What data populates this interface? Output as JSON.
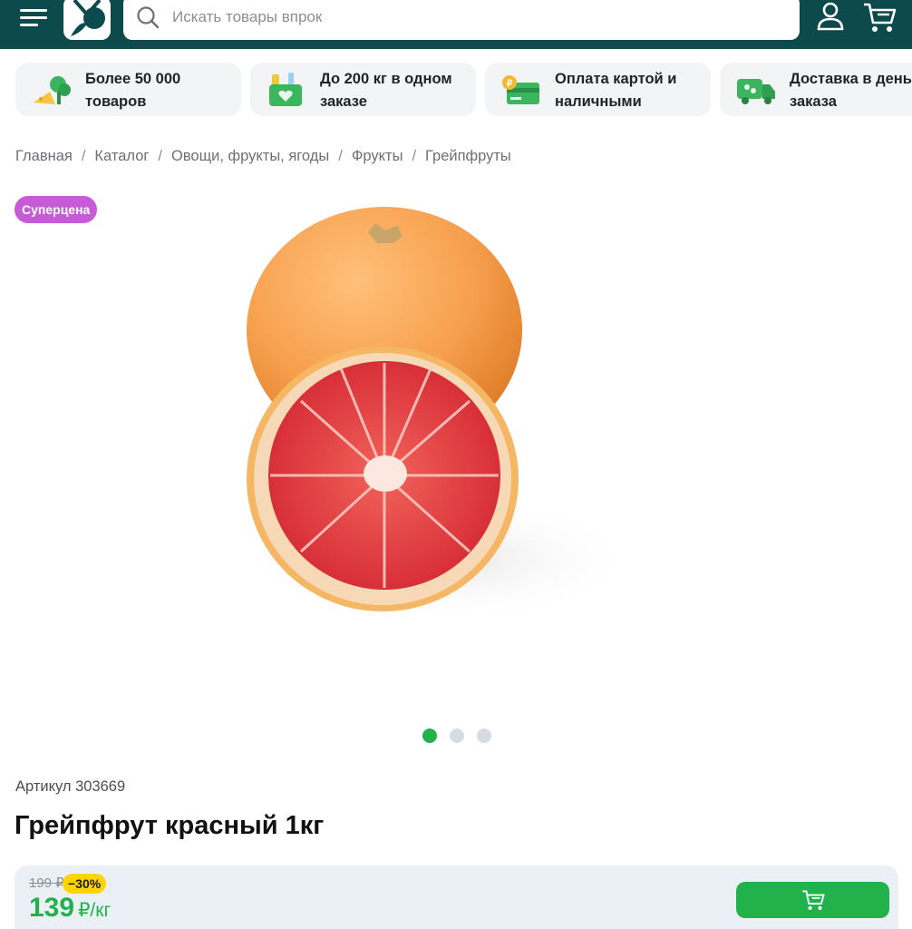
{
  "header": {
    "search_placeholder": "Искать товары впрок",
    "bg_color": "#0d4a4c"
  },
  "features": [
    {
      "icon": "vegetables-icon",
      "label": "Более 50 000 товаров"
    },
    {
      "icon": "grocery-bag-icon",
      "label": "До 200 кг в одном заказе"
    },
    {
      "icon": "payment-card-icon",
      "label": "Оплата картой и наличными"
    },
    {
      "icon": "delivery-truck-icon",
      "label": "Доставка в день заказа"
    }
  ],
  "breadcrumbs": [
    "Главная",
    "Каталог",
    "Овощи, фрукты, ягоды",
    "Фрукты",
    "Грейпфруты"
  ],
  "breadcrumb_separator": "/",
  "product": {
    "badge": "Суперцена",
    "sku": "Артикул 303669",
    "title": "Грейпфрут красный 1кг",
    "old_price": "199 ₽",
    "discount": "−30%",
    "price": "139",
    "price_unit": "₽/кг",
    "carousel": {
      "count": 3,
      "active_index": 0
    }
  },
  "colors": {
    "accent_green": "#22b24c",
    "badge_purple": "#c75ad6",
    "discount_yellow": "#ffd500"
  }
}
